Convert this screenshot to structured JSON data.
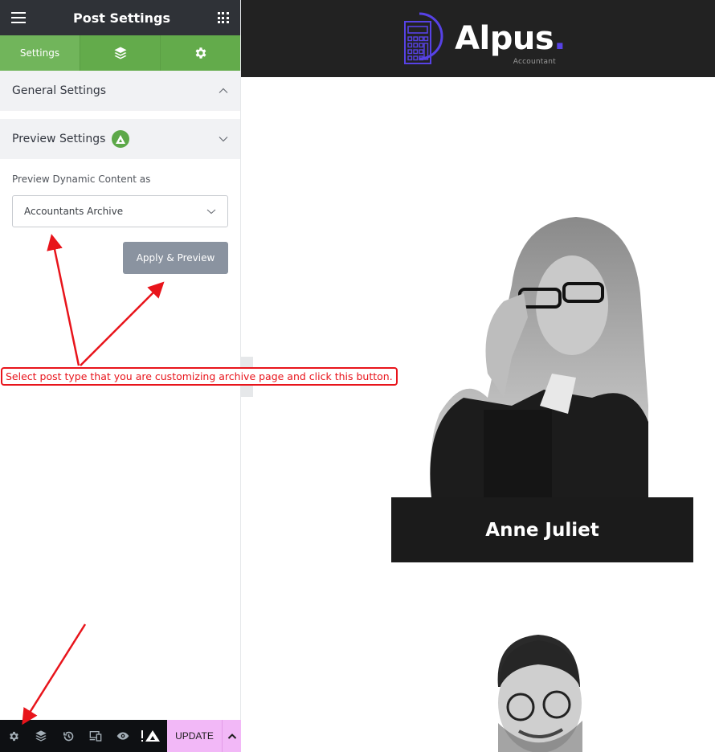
{
  "sidebar": {
    "title": "Post Settings",
    "menu_icon": "hamburger-icon",
    "apps_icon": "grid-icon",
    "tabs": [
      {
        "label": "Settings",
        "icon": "none",
        "active": true
      },
      {
        "label": "",
        "icon": "layers-icon",
        "active": false
      },
      {
        "label": "",
        "icon": "gear-icon",
        "active": false
      }
    ],
    "sections": {
      "general": {
        "label": "General Settings",
        "expanded": true
      },
      "preview": {
        "label": "Preview Settings",
        "expanded": false,
        "badge_icon": "alpus-logo-icon"
      }
    },
    "preview_field": {
      "label": "Preview Dynamic Content as",
      "selected": "Accountants Archive"
    },
    "apply_button": "Apply & Preview"
  },
  "bottombar": {
    "icons": [
      "gear-icon",
      "layers-icon",
      "history-icon",
      "responsive-icon",
      "eye-icon",
      "alpus-logo-icon"
    ],
    "update_label": "UPDATE"
  },
  "site": {
    "logo_text": "Alpus",
    "logo_dot": ".",
    "logo_subtitle": "Accountant",
    "brand_color": "#5742e6",
    "members": [
      {
        "name": "Anne Juliet"
      }
    ]
  },
  "annotation": {
    "text": "Select post type that you are customizing archive page and click this button.",
    "color": "#e8141b"
  }
}
